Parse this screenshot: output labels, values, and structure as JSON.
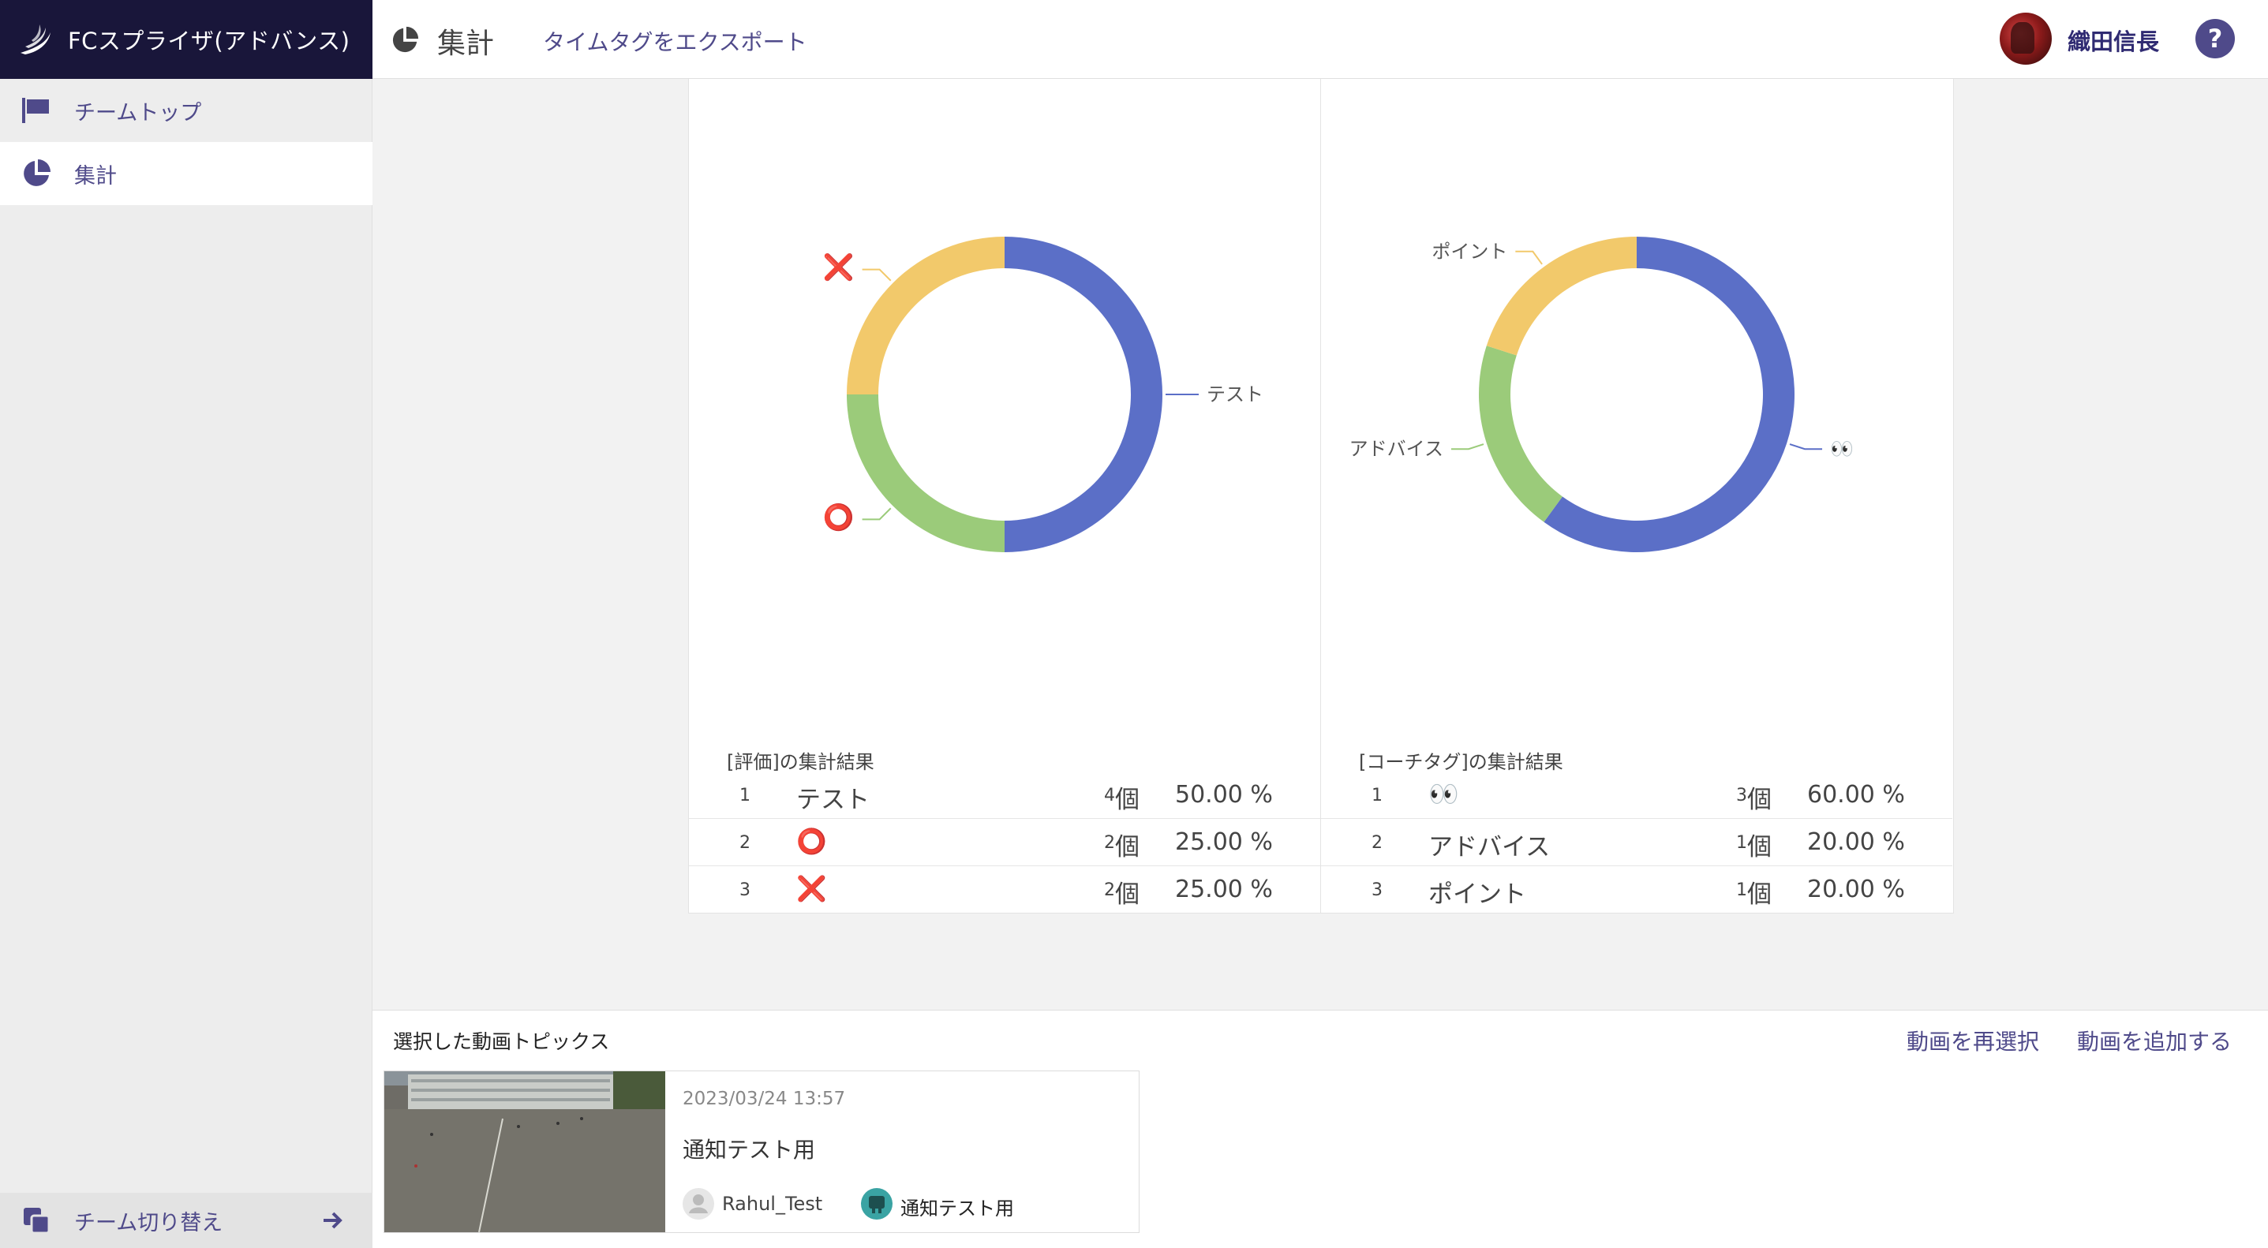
{
  "app": {
    "brand_name": "FCスプライザ(アドバンス)"
  },
  "sidebar": {
    "items": [
      {
        "label": "チームトップ",
        "icon": "flag-icon"
      },
      {
        "label": "集計",
        "icon": "pie-chart-icon",
        "active": true
      }
    ],
    "team_switch_label": "チーム切り替え"
  },
  "header": {
    "title": "集計",
    "export_label": "タイムタグをエクスポート",
    "user_name": "織田信長",
    "help_label": "?"
  },
  "colors": {
    "accent": "#4f4a8a",
    "brand_bg": "#19163a",
    "slice_blue": "#5b6fc7",
    "slice_green": "#9bcb7a",
    "slice_yellow": "#f2c96b",
    "mark_red": "#dd2222"
  },
  "chart_data": [
    {
      "type": "pie",
      "title": "[評価]の集計結果",
      "categories": [
        "テスト",
        "⭕",
        "❌"
      ],
      "values": [
        50.0,
        25.0,
        25.0
      ],
      "counts": [
        4,
        2,
        2
      ]
    },
    {
      "type": "pie",
      "title": "[コーチタグ]の集計結果",
      "categories": [
        "👀",
        "アドバイス",
        "ポイント"
      ],
      "values": [
        60.0,
        20.0,
        20.0
      ],
      "counts": [
        3,
        1,
        1
      ]
    }
  ],
  "results": {
    "unit": "個",
    "left": {
      "title": "[評価]の集計結果",
      "rows": [
        {
          "rank": "1",
          "label": "テスト",
          "count": "4",
          "pct": "50.00 %"
        },
        {
          "rank": "2",
          "label": "⭕",
          "count": "2",
          "pct": "25.00 %"
        },
        {
          "rank": "3",
          "label": "❌",
          "count": "2",
          "pct": "25.00 %"
        }
      ]
    },
    "right": {
      "title": "[コーチタグ]の集計結果",
      "rows": [
        {
          "rank": "1",
          "label": "👀",
          "count": "3",
          "pct": "60.00 %"
        },
        {
          "rank": "2",
          "label": "アドバイス",
          "count": "1",
          "pct": "20.00 %"
        },
        {
          "rank": "3",
          "label": "ポイント",
          "count": "1",
          "pct": "20.00 %"
        }
      ]
    }
  },
  "bottom": {
    "title": "選択した動画トピックス",
    "reselect_label": "動画を再選択",
    "add_label": "動画を追加する",
    "video": {
      "date": "2023/03/24 13:57",
      "title": "通知テスト用",
      "user": "Rahul_Test",
      "group": "通知テスト用"
    }
  }
}
